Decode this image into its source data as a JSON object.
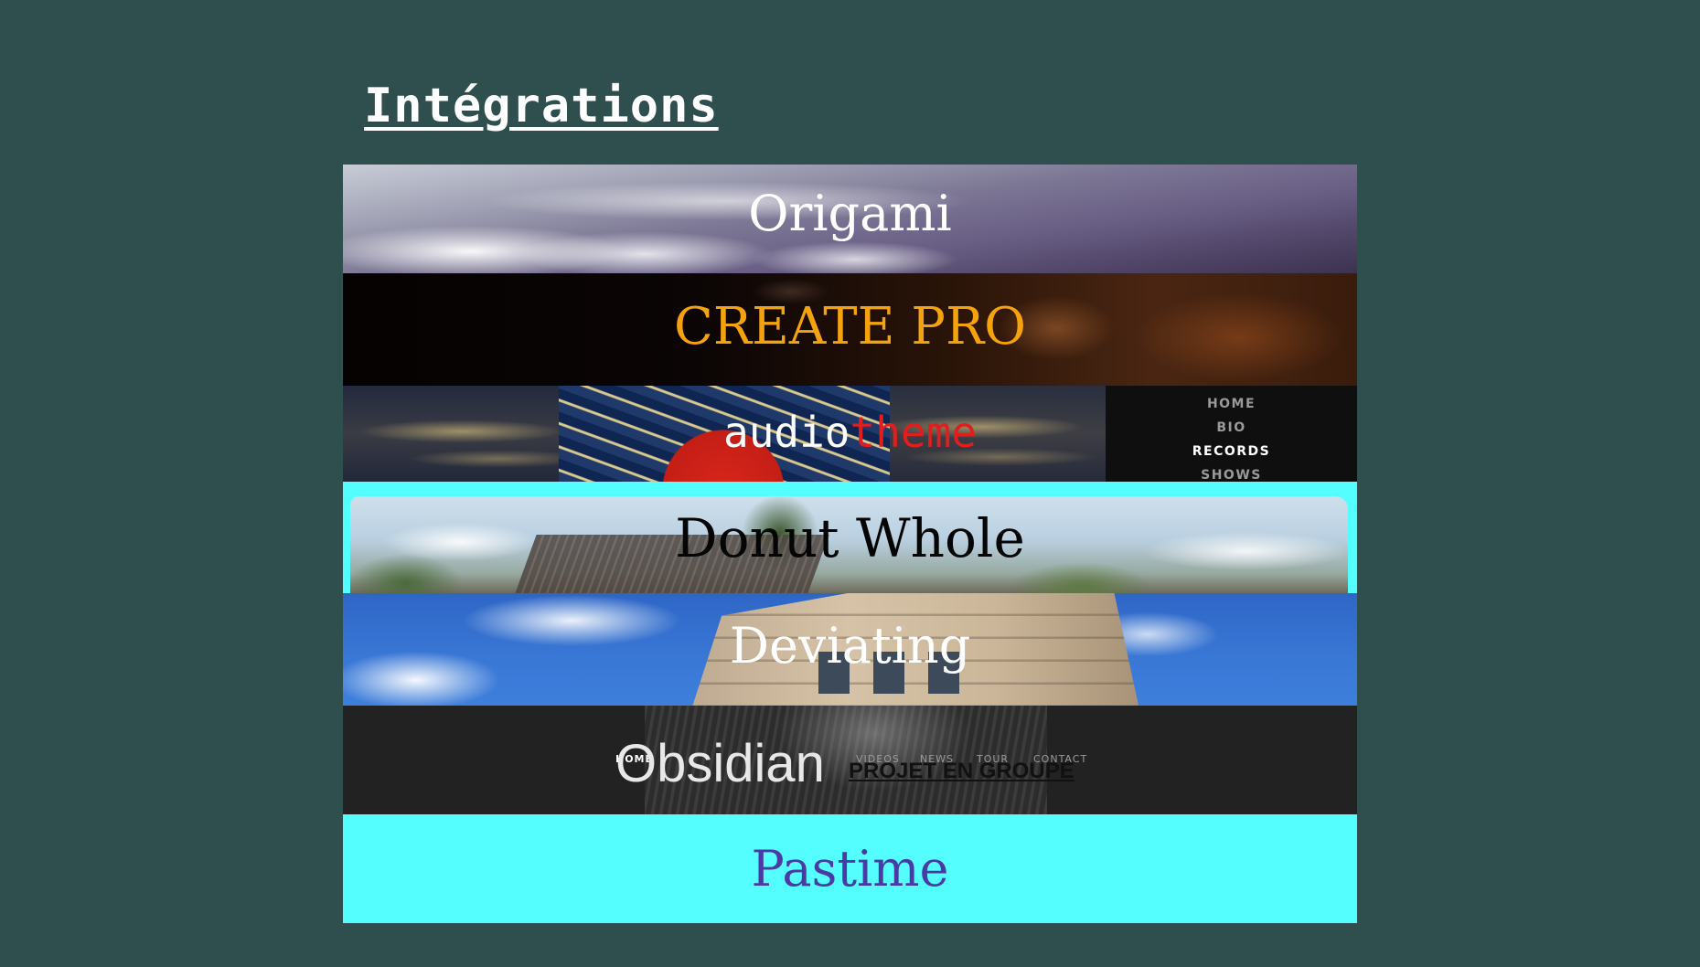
{
  "page": {
    "title": "Intégrations",
    "background_color": "#2f4f4f"
  },
  "integrations": [
    {
      "name": "Origami",
      "text_color": "#ffffff"
    },
    {
      "name": "CREATE PRO",
      "text_color": "#f5a30c"
    },
    {
      "name_part1": "audio",
      "name_part2": "theme",
      "part1_color": "#ffffff",
      "part2_color": "#e01e1e",
      "nav": [
        "HOME",
        "BIO",
        "RECORDS",
        "SHOWS"
      ],
      "nav_active": "RECORDS"
    },
    {
      "name": "Donut Whole",
      "text_color": "#050505",
      "background": "#55fefe"
    },
    {
      "name": "Deviating",
      "text_color": "#ffffff"
    },
    {
      "name": "Obsidian",
      "text_color": "#e8e8e8",
      "nav": [
        "HOME",
        "VIDEOS",
        "NEWS",
        "TOUR",
        "CONTACT"
      ],
      "nav_active": "HOME",
      "link": "PROJET EN GROUPE"
    },
    {
      "name": "Pastime",
      "text_color": "#4b3aa6",
      "background": "#55fefe"
    }
  ]
}
